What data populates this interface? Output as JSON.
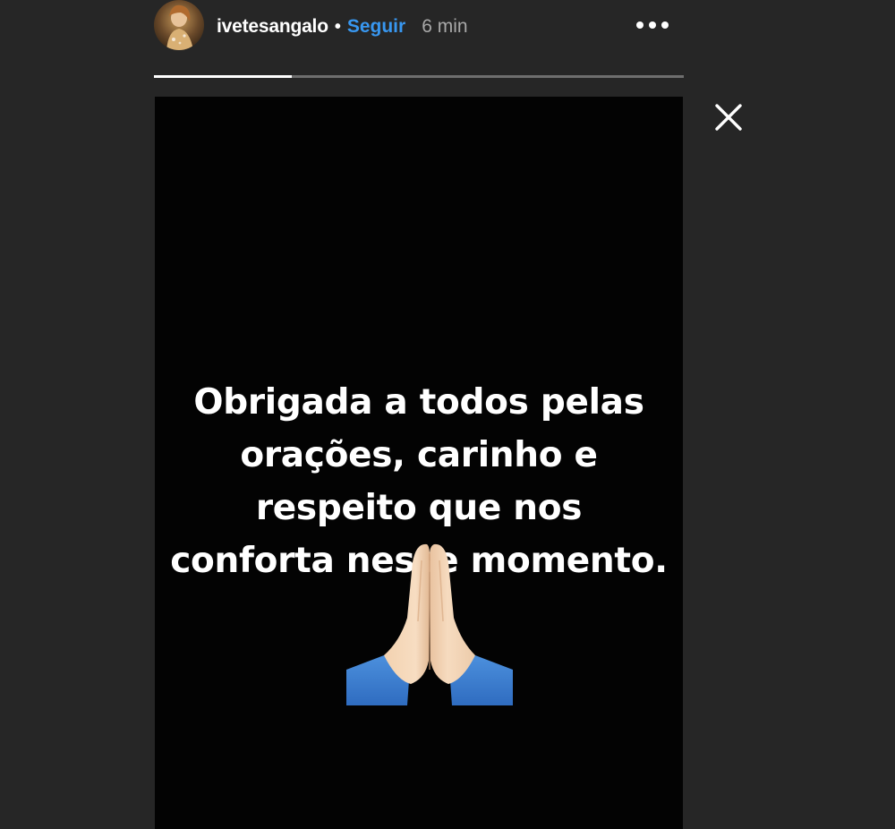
{
  "header": {
    "username": "ivetesangalo",
    "separator": "•",
    "follow_label": "Seguir",
    "time_ago": "6 min",
    "more_icon": "more-horizontal-icon",
    "close_icon": "close-icon"
  },
  "progress": {
    "segments": 1,
    "fraction": 0.26
  },
  "story": {
    "text_lines": [
      "Obrigada a todos pelas",
      "orações, carinho e",
      "respeito que nos",
      "conforta nesse momento."
    ],
    "emoji": "folded-hands-emoji"
  },
  "colors": {
    "background": "#262626",
    "story_background": "#030303",
    "follow_blue": "#3897f0",
    "text_white": "#ffffff",
    "time_gray": "#a8a8a8"
  }
}
